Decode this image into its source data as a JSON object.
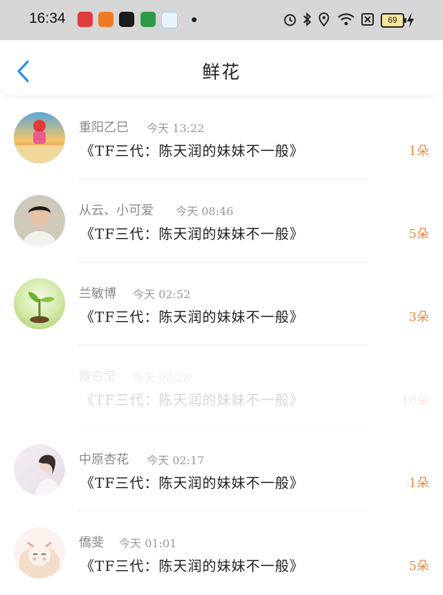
{
  "status_bar": {
    "time": "16:34",
    "battery": "69",
    "apps": [
      "app-icon-red",
      "app-icon-orange",
      "tiktok-icon",
      "oppo-icon",
      "blue-app-icon"
    ]
  },
  "header": {
    "title": "鲜花",
    "back_icon": "chevron-left-icon"
  },
  "colors": {
    "accent_blue": "#2f8fe8",
    "count_orange": "#e7894a"
  },
  "items": [
    {
      "name": "重阳乙巳",
      "time": "今天 13:22",
      "message": "《TF三代：陈天润的妹妹不一般》",
      "count": "1朵",
      "avatar": "avatar-cartoon"
    },
    {
      "name": "从云、小可爱",
      "time": "今天 08:46",
      "message": "《TF三代：陈天润的妹妹不一般》",
      "count": "5朵",
      "avatar": "avatar-boy"
    },
    {
      "name": "兰敏博",
      "time": "今天 02:52",
      "message": "《TF三代：陈天润的妹妹不一般》",
      "count": "3朵",
      "avatar": "avatar-sprout"
    },
    {
      "name": "睢白莹",
      "time": "今天 02:28",
      "message": "《TF三代：陈天润的妹妹不一般》",
      "count": "10朵",
      "avatar": ""
    },
    {
      "name": "中原杏花",
      "time": "今天 02:17",
      "message": "《TF三代：陈天润的妹妹不一般》",
      "count": "1朵",
      "avatar": "avatar-girl"
    },
    {
      "name": "僑斐",
      "time": "今天 01:01",
      "message": "《TF三代：陈天润的妹妹不一般》",
      "count": "5朵",
      "avatar": "avatar-anime"
    }
  ]
}
